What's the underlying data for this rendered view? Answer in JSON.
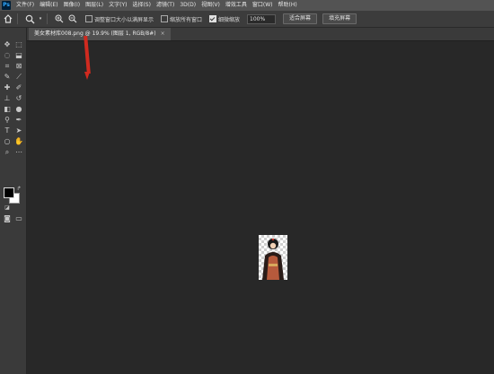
{
  "app": {
    "logo": "Ps",
    "menu": [
      "文件(F)",
      "编辑(E)",
      "图像(I)",
      "图层(L)",
      "文字(Y)",
      "选择(S)",
      "滤镜(T)",
      "3D(D)",
      "视图(V)",
      "增效工具",
      "窗口(W)",
      "帮助(H)"
    ]
  },
  "options": {
    "resize_windows_label": "调整窗口大小以满屏显示",
    "zoom_all_label": "缩放所有窗口",
    "scrubby_zoom_label": "细微缩放",
    "zoom_value": "100%",
    "fit_screen_label": "适合屏幕",
    "fill_screen_label": "填充屏幕"
  },
  "document": {
    "tab_title": "美女素材库008.png @ 19.9% (图层 1, RGB/8#)",
    "tab_close": "×"
  }
}
